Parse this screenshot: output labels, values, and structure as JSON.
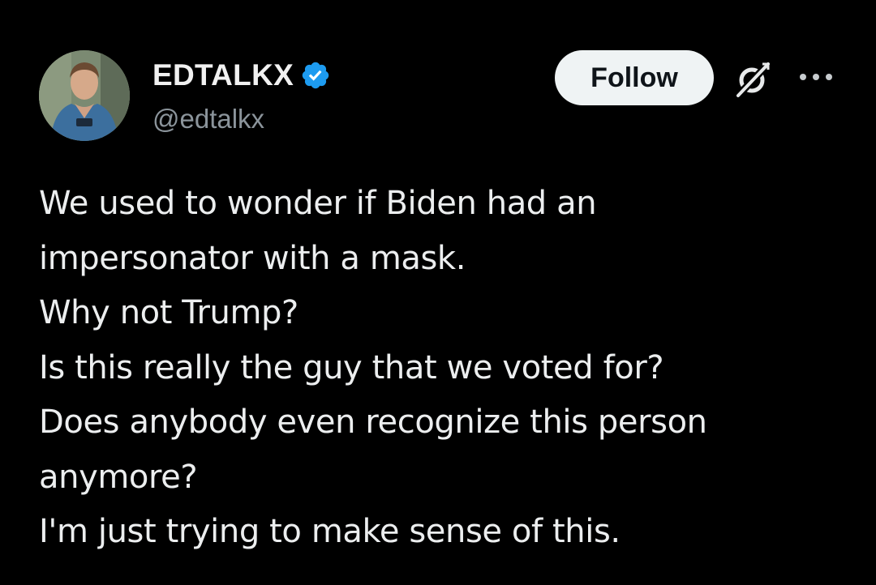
{
  "author": {
    "display_name": "EDTALKX",
    "handle": "@edtalkx",
    "verified": true
  },
  "actions": {
    "follow_label": "Follow",
    "grok_icon": "grok-icon",
    "more_icon": "more-icon"
  },
  "tweet": {
    "lines": [
      "We used to wonder if Biden had an",
      "impersonator with a mask.",
      "Why not Trump?",
      "Is this really the guy that we voted for?",
      "Does anybody even recognize this person",
      "anymore?",
      "I'm just trying to make sense of this."
    ]
  },
  "colors": {
    "background": "#000000",
    "text": "#e7e9ea",
    "secondary_text": "#8b949b",
    "verified_blue": "#1d9bf0",
    "follow_bg": "#eff3f4"
  }
}
